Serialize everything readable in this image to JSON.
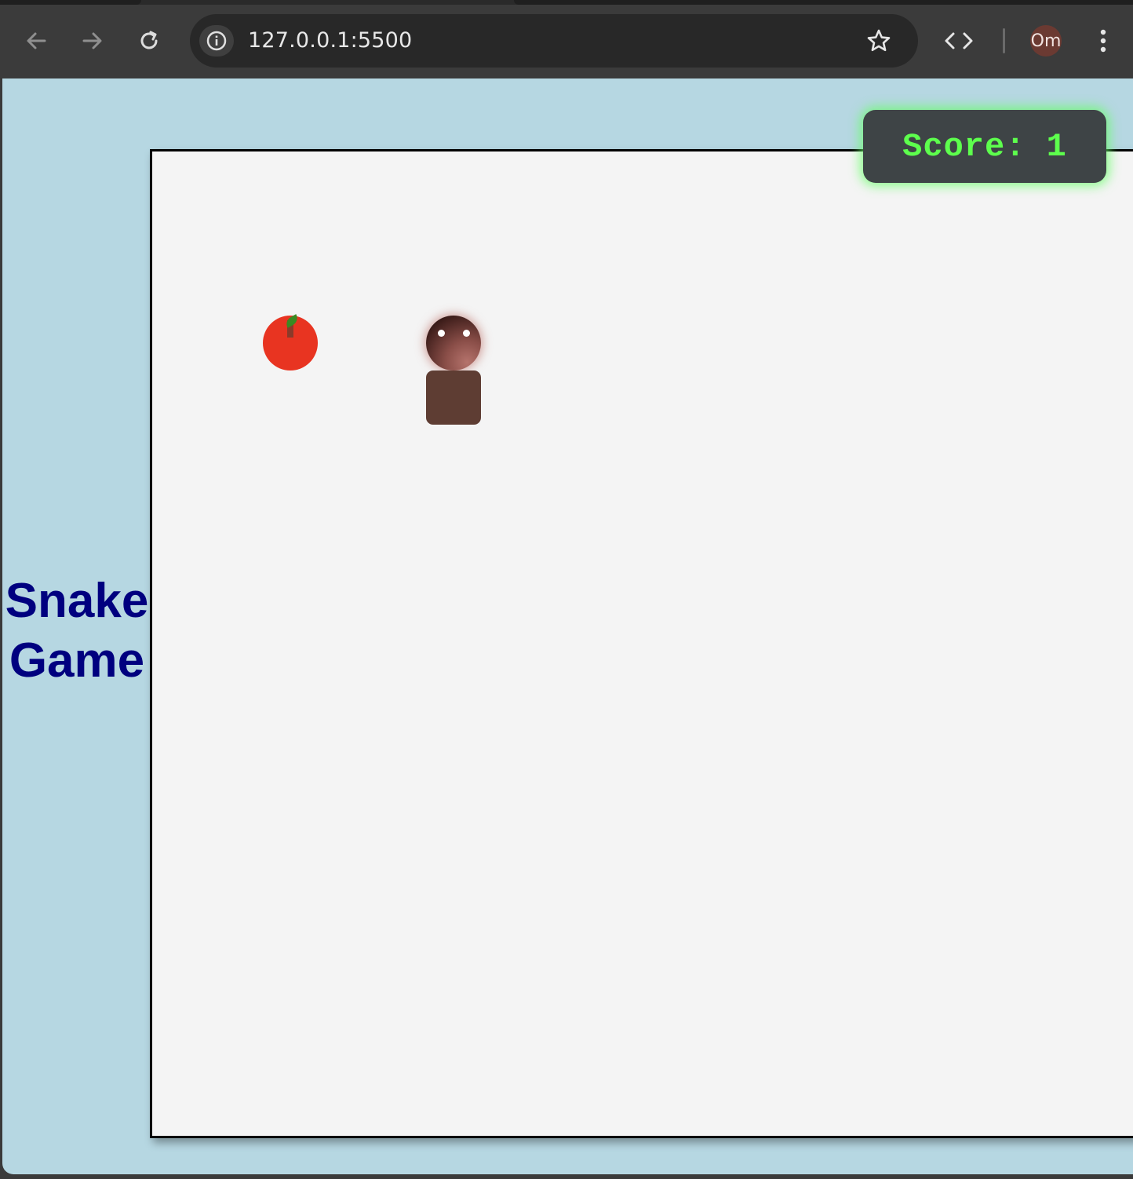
{
  "browser": {
    "url": "127.0.0.1:5500",
    "profile_initials": "Om",
    "icons": {
      "back": "arrow-left-icon",
      "forward": "arrow-right-icon",
      "reload": "reload-icon",
      "site_info": "info-icon",
      "bookmark": "star-icon",
      "devtools": "code-icon",
      "menu": "kebab-menu-icon"
    }
  },
  "page": {
    "title_line1": "Snake",
    "title_line2": "Game",
    "score_label": "Score: 1",
    "colors": {
      "background": "#b6d7e2",
      "board": "#f4f4f4",
      "title": "#00007f",
      "score_text": "#5dff4d",
      "score_panel": "#3e4446",
      "apple": "#e83421",
      "snake_body": "#5e3d33"
    }
  },
  "game": {
    "score": 1,
    "snake_length": 2
  }
}
